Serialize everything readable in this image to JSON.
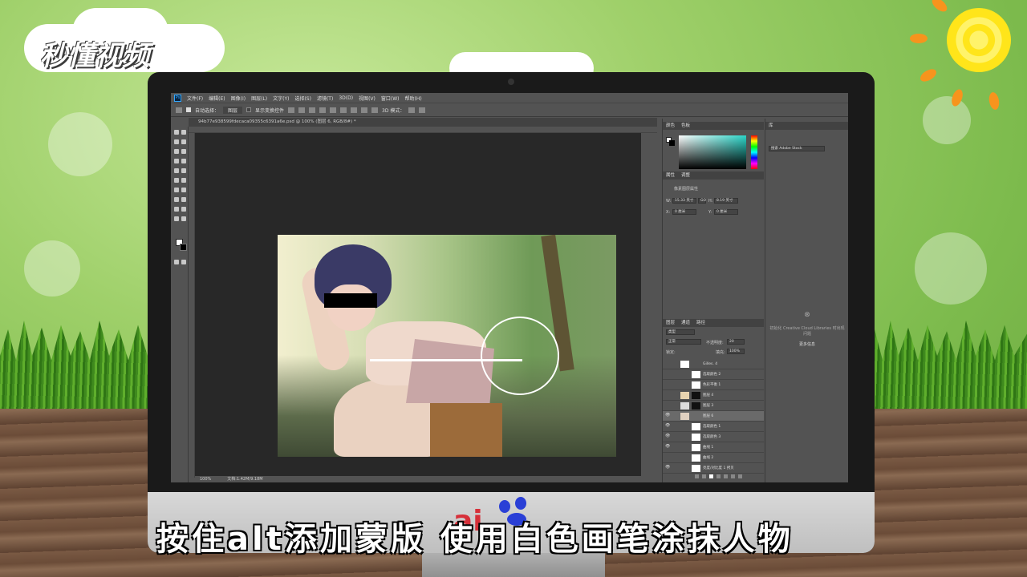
{
  "logo": {
    "text": "秒懂视频"
  },
  "caption": {
    "text": "按住alt添加蒙版 使用白色画笔涂抹人物"
  },
  "watermark": {
    "text": "ai"
  },
  "photoshop": {
    "app_icon": "Ps",
    "menus": [
      "文件(F)",
      "编辑(E)",
      "图像(I)",
      "图层(L)",
      "文字(Y)",
      "选择(S)",
      "滤镜(T)",
      "3D(D)",
      "视图(V)",
      "窗口(W)",
      "帮助(H)"
    ],
    "options": {
      "auto_select_label": "自动选择：",
      "auto_select_value": "图层",
      "show_transform_label": "显示变换控件",
      "mode_3d": "3D 模式："
    },
    "document_tab": "94b77e938599fdecaca09355c6391a6e.psd @ 100% (图层 6, RGB/8#) *",
    "status": {
      "zoom": "100%",
      "doc_size": "文档:1.42M/9.18M"
    },
    "color_panel": {
      "tabs": [
        "颜色",
        "色板"
      ]
    },
    "libraries_panel": {
      "tab": "库",
      "search_placeholder": "搜索 Adobe Stock",
      "message": "初始化 Creative Cloud Libraries 时出现问题",
      "more_info": "更多信息"
    },
    "properties_panel": {
      "tabs": [
        "属性",
        "调整"
      ],
      "title": "像素图层属性",
      "w_label": "W:",
      "w_value": "15.33 英寸",
      "h_label": "H:",
      "h_value": "8.19 英寸",
      "x_label": "X:",
      "x_value": "0 厘米",
      "y_label": "Y:",
      "y_value": "0 厘米",
      "link_label": "GO"
    },
    "layers_panel": {
      "tabs": [
        "图层",
        "通道",
        "路径"
      ],
      "filter_kind": "类型",
      "blend_mode": "正常",
      "opacity_label": "不透明度:",
      "opacity_value": "20",
      "lock_label": "锁定:",
      "fill_label": "填充:",
      "fill_value": "100%",
      "layers": [
        {
          "name": "Gilles. 4",
          "visible": false,
          "selected": false
        },
        {
          "name": "选取颜色 2",
          "visible": false,
          "selected": false
        },
        {
          "name": "色彩平衡 1",
          "visible": false,
          "selected": false
        },
        {
          "name": "图层 4",
          "visible": false,
          "selected": false
        },
        {
          "name": "图层 3",
          "visible": false,
          "selected": false
        },
        {
          "name": "图层 6",
          "visible": true,
          "selected": true
        },
        {
          "name": "选取颜色 1",
          "visible": true,
          "selected": false
        },
        {
          "name": "选取颜色 3",
          "visible": true,
          "selected": false
        },
        {
          "name": "曲线 1",
          "visible": true,
          "selected": false
        },
        {
          "name": "曲线 2",
          "visible": false,
          "selected": false
        },
        {
          "name": "亮度/对比度 1 拷贝",
          "visible": true,
          "selected": false
        }
      ]
    }
  },
  "colors": {
    "accent": "#31a8ff",
    "ps_bg": "#535353",
    "canvas_bg": "#282828"
  }
}
